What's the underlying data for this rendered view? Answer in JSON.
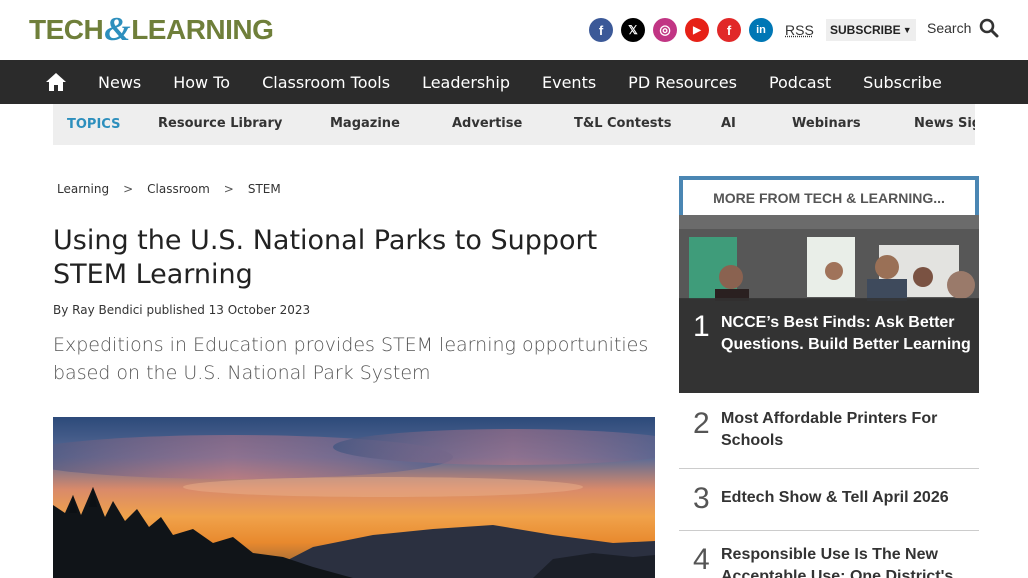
{
  "header": {
    "logo_left": "TECH",
    "logo_amp": "&",
    "logo_right": "LEARNING",
    "social": [
      {
        "name": "facebook-icon",
        "glyph": "f",
        "color": "#3b5998"
      },
      {
        "name": "x-icon",
        "glyph": "𝕏",
        "color": "#000000"
      },
      {
        "name": "instagram-icon",
        "glyph": "◎",
        "color": "#c13584"
      },
      {
        "name": "youtube-icon",
        "glyph": "▶",
        "color": "#e62117"
      },
      {
        "name": "flipboard-icon",
        "glyph": "f",
        "color": "#e12828"
      },
      {
        "name": "linkedin-icon",
        "glyph": "in",
        "color": "#0077b5"
      }
    ],
    "rss_label": "RSS",
    "subscribe_label": "SUBSCRIBE",
    "search_label": "Search"
  },
  "nav": {
    "items": [
      "News",
      "How To",
      "Classroom Tools",
      "Leadership",
      "Events",
      "PD Resources",
      "Podcast",
      "Subscribe"
    ]
  },
  "topics": {
    "label": "TOPICS",
    "items": [
      "Resource Library",
      "Magazine",
      "Advertise",
      "T&L Contests",
      "AI",
      "Webinars",
      "News Sig"
    ]
  },
  "breadcrumb": {
    "items": [
      "Learning",
      "Classroom",
      "STEM"
    ],
    "separator": ">"
  },
  "article": {
    "title": "Using the U.S. National Parks to Support STEM Learning",
    "by_prefix": "By",
    "author": "Ray Bendici",
    "published_prefix": "published",
    "date": "13 October 2023",
    "subtitle": "Expeditions in Education provides STEM learning opportunities based on the U.S. National Park System"
  },
  "sidebar": {
    "heading": "MORE FROM TECH & LEARNING...",
    "items": [
      {
        "rank": "1",
        "title": "NCCE’s Best Finds: Ask Better Questions. Build Better Learning"
      },
      {
        "rank": "2",
        "title": "Most Affordable Printers For Schools"
      },
      {
        "rank": "3",
        "title": "Edtech Show & Tell April 2026"
      },
      {
        "rank": "4",
        "title": "Responsible Use Is The New Acceptable Use: One District's"
      }
    ]
  },
  "colors": {
    "nav_bg": "#2b2b2b",
    "accent_blue": "#2d8fbd",
    "logo_green": "#6f7f3a",
    "sidebar_border": "#4a86b3"
  }
}
